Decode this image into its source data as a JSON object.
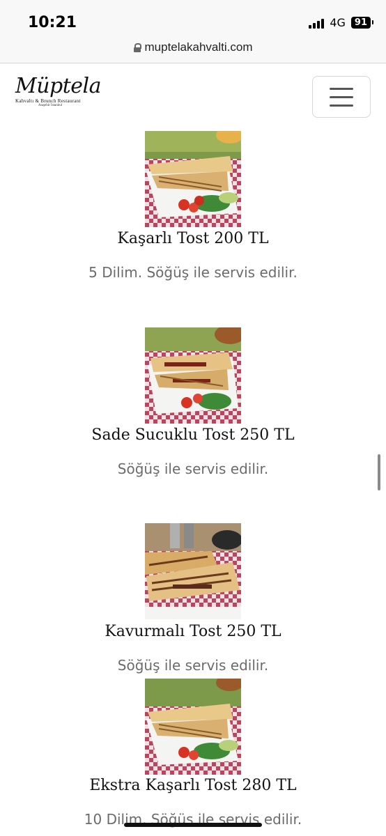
{
  "status": {
    "time": "10:21",
    "network": "4G",
    "battery": "91"
  },
  "browser": {
    "url": "muptelakahvalti.com"
  },
  "site": {
    "logo_name": "Müptela",
    "logo_tagline": "Kahvaltı & Brunch Restaurant",
    "logo_location": "Ataşehir İstanbul",
    "menu_icon": "hamburger-icon"
  },
  "items": [
    {
      "title": "Kaşarlı Tost 200 TL",
      "desc": "5 Dilim. Söğüş ile servis edilir.",
      "image": "cheese-toast-photo"
    },
    {
      "title": "Sade Sucuklu Tost 250 TL",
      "desc": "Söğüş ile servis edilir.",
      "image": "sucuk-toast-photo"
    },
    {
      "title": "Kavurmalı Tost 250 TL",
      "desc": "Söğüş ile servis edilir.",
      "image": "kavurma-toast-photo"
    },
    {
      "title": "Ekstra Kaşarlı Tost 280 TL",
      "desc": "10 Dilim. Söğüş ile servis edilir.",
      "image": "extra-cheese-toast-photo"
    }
  ]
}
